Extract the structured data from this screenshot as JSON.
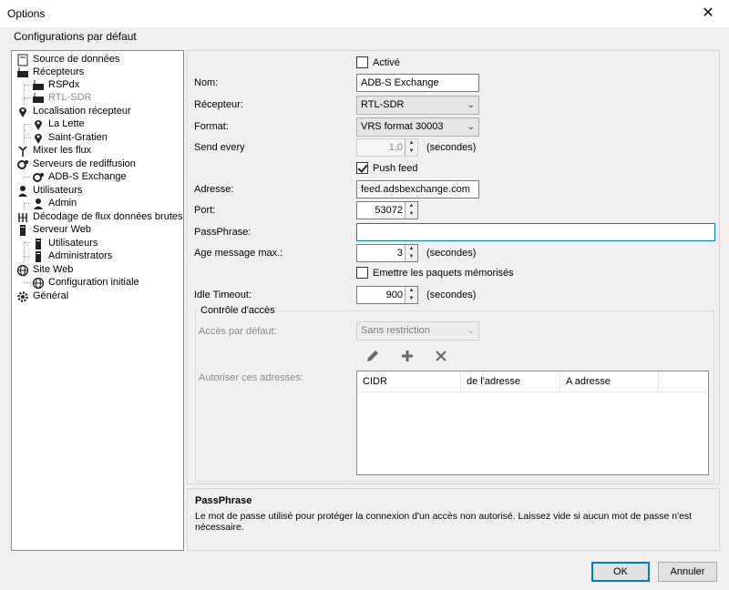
{
  "window": {
    "title": "Options",
    "close_glyph": "✕"
  },
  "subtitle": "Configurations par défaut",
  "tree": [
    {
      "label": "Source de données",
      "icon": "document-icon",
      "disabled": false
    },
    {
      "label": "Récepteurs",
      "icon": "receiver-icon",
      "disabled": false
    },
    {
      "label": "RSPdx",
      "icon": "receiver-icon",
      "disabled": false
    },
    {
      "label": "RTL-SDR",
      "icon": "receiver-icon",
      "disabled": true
    },
    {
      "label": "Localisation récepteur",
      "icon": "pin-icon",
      "disabled": false
    },
    {
      "label": "La Lette",
      "icon": "pin-icon",
      "disabled": false
    },
    {
      "label": "Saint-Gratien",
      "icon": "pin-icon",
      "disabled": false
    },
    {
      "label": "Mixer les flux",
      "icon": "merge-icon",
      "disabled": false
    },
    {
      "label": "Serveurs de rediffusion",
      "icon": "gears-icon",
      "disabled": false
    },
    {
      "label": "ADB-S Exchange",
      "icon": "gears-icon",
      "disabled": false
    },
    {
      "label": "Utilisateurs",
      "icon": "user-icon",
      "disabled": false
    },
    {
      "label": "Admin",
      "icon": "user-icon",
      "disabled": false
    },
    {
      "label": "Décodage de flux données brutes",
      "icon": "decode-icon",
      "disabled": false
    },
    {
      "label": "Serveur Web",
      "icon": "server-icon",
      "disabled": false
    },
    {
      "label": "Utilisateurs",
      "icon": "server-icon",
      "disabled": false
    },
    {
      "label": "Administrators",
      "icon": "server-icon",
      "disabled": false
    },
    {
      "label": "Site Web",
      "icon": "globe-icon",
      "disabled": false
    },
    {
      "label": "Configuration initiale",
      "icon": "globe-icon",
      "disabled": false
    },
    {
      "label": "Général",
      "icon": "gear-icon",
      "disabled": false
    }
  ],
  "form": {
    "active_label": "Activé",
    "active_checked": false,
    "name_label": "Nom:",
    "name_value": "ADB-S Exchange",
    "receiver_label": "Récepteur:",
    "receiver_value": "RTL-SDR",
    "format_label": "Format:",
    "format_value": "VRS format 30003",
    "send_every_label": "Send every",
    "send_every_value": "1,0",
    "seconds_label": "(secondes)",
    "push_feed_label": "Push feed",
    "push_feed_checked": true,
    "address_label": "Adresse:",
    "address_value": "feed.adsbexchange.com",
    "port_label": "Port:",
    "port_value": "53072",
    "passphrase_label": "PassPhrase:",
    "passphrase_value": "",
    "age_label": "Age message max.:",
    "age_value": "3",
    "emit_label": "Emettre les paquets mémorisés",
    "emit_checked": false,
    "idle_label": "Idle Timeout:",
    "idle_value": "900"
  },
  "access": {
    "group_title": "Contrôle d'accès",
    "default_label": "Accès par défaut:",
    "default_value": "Sans restriction",
    "allow_label": "Autoriser ces adresses:",
    "columns": [
      "CIDR",
      "de l'adresse",
      "A adresse"
    ]
  },
  "help": {
    "title": "PassPhrase",
    "text": "Le mot de passe utilisé pour protéger la connexion d'un accès non autorisé. Laissez vide si aucun mot de passe n'est nécessaire."
  },
  "buttons": {
    "ok": "OK",
    "cancel": "Annuler"
  },
  "colors": {
    "accent": "#0078d7",
    "panel": "#f0f0f0"
  }
}
